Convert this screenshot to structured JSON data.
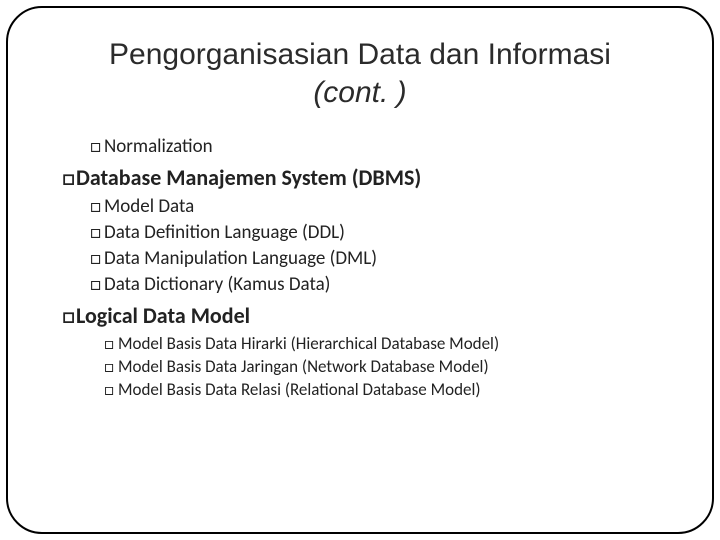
{
  "title_line1": "Pengorganisasian Data dan Informasi",
  "title_line2": "(cont. )",
  "bullet_glyph": "□",
  "sections": {
    "orphan": {
      "item": "Normalization"
    },
    "dbms": {
      "heading": "Database Manajemen System (DBMS)",
      "items": [
        "Model Data",
        "Data Definition Language (DDL)",
        "Data Manipulation Language (DML)",
        "Data Dictionary (Kamus Data)"
      ]
    },
    "ldm": {
      "heading": "Logical Data Model",
      "items": [
        "Model Basis Data Hirarki (Hierarchical Database Model)",
        "Model Basis Data Jaringan (Network Database Model)",
        "Model Basis Data Relasi (Relational Database Model)"
      ]
    }
  }
}
